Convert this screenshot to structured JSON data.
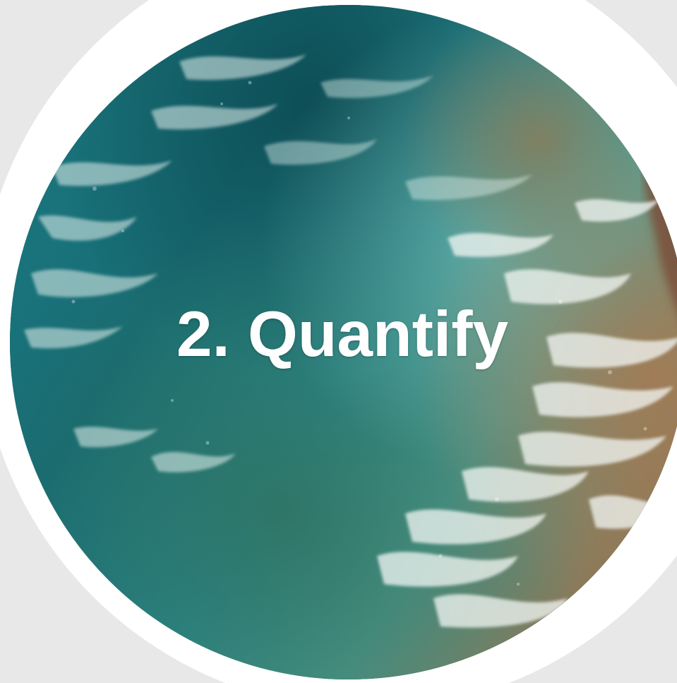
{
  "slide": {
    "title": "2. Quantify",
    "image_subject": "aerial-ocean-waves",
    "colors": {
      "background": "#e8e8e8",
      "ring": "#ffffff",
      "water_dark": "#0d4d55",
      "water_teal": "#2a8a8f",
      "water_light": "#5fb0ad",
      "sand": "#a07a55",
      "foam": "#f2f6f4",
      "text": "#ffffff"
    }
  }
}
